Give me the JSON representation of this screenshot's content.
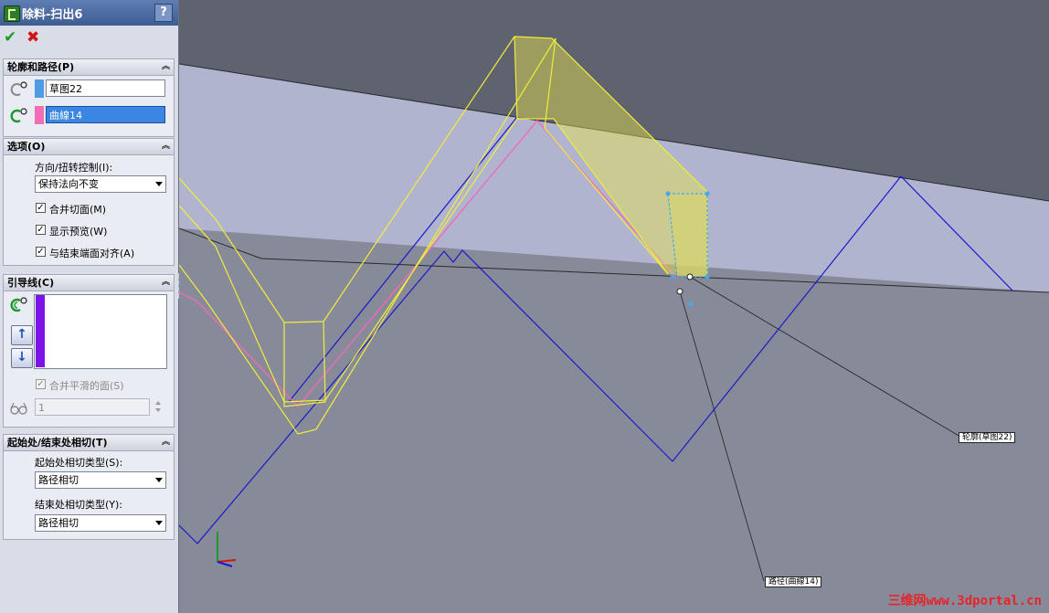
{
  "title_bar": {
    "title": "除料-扫出6",
    "help": "?"
  },
  "actions": {
    "ok": "✔",
    "cancel": "✖"
  },
  "profile_path": {
    "header": "轮廓和路径(P)",
    "profile_value": "草图22",
    "path_value": "曲線14",
    "colors": {
      "profile": "#4f9be6",
      "path": "#ee6fb6"
    }
  },
  "options": {
    "header": "选项(O)",
    "orientation_label": "方向/扭转控制(I):",
    "orientation_value": "保持法向不变",
    "merge_tangent": "合并切面(M)",
    "show_preview": "显示预览(W)",
    "align_end": "与结束端面对齐(A)"
  },
  "guides": {
    "header": "引导线(C)",
    "merge_smooth": "合并平滑的面(S)",
    "count_value": "1",
    "up_arrow": "↑",
    "down_arrow": "↓",
    "color": "#7c14e8"
  },
  "tangency": {
    "header": "起始处/结束处相切(T)",
    "start_label": "起始处相切类型(S):",
    "start_value": "路径相切",
    "end_label": "结束处相切类型(Y):",
    "end_value": "路径相切"
  },
  "viewport": {
    "profile_tag": "轮廓(草图22)",
    "path_tag": "路径(曲線14)",
    "watermark": "三维网www.3dportal.cn"
  },
  "icons": {
    "collapse": "︽",
    "checkmark": "✓"
  }
}
